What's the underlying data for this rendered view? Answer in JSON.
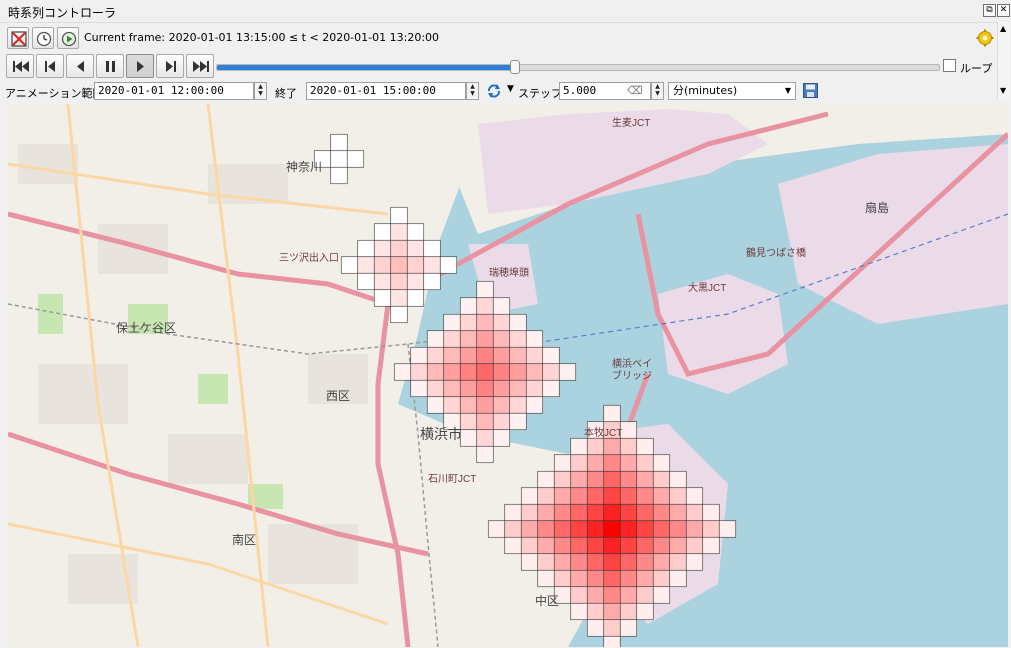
{
  "panel": {
    "title": "時系列コントローラ",
    "restore_symbol": "⧉",
    "close_symbol": "✕"
  },
  "frame": {
    "label": "Current frame: 2020-01-01 13:15:00 ≤ t < 2020-01-01 13:20:00"
  },
  "playback": {
    "buttons": [
      "skip-to-start",
      "step-back",
      "play-backward",
      "pause",
      "play-forward",
      "step-forward",
      "skip-to-end"
    ],
    "slider_fraction": 0.413,
    "loop_label": "ループ",
    "loop_checked": false
  },
  "range": {
    "animation_range_label": "アニメーション範囲",
    "start": "2020-01-01 12:00:00",
    "end_label": "終了",
    "end": "2020-01-01 15:00:00",
    "step_label": "ステップ",
    "step_value": "5.000",
    "unit": "分(minutes)"
  },
  "map": {
    "labels": [
      {
        "name": "kanagawa",
        "text": "神奈川"
      },
      {
        "name": "hodogaya-ku",
        "text": "保土ケ谷区"
      },
      {
        "name": "nishi-ku",
        "text": "西区"
      },
      {
        "name": "yokohama-shi",
        "text": "横浜市"
      },
      {
        "name": "minami-ku",
        "text": "南区"
      },
      {
        "name": "naka-ku",
        "text": "中区"
      },
      {
        "name": "ogishima",
        "text": "扇島"
      },
      {
        "name": "mizuho-pier",
        "text": "瑞穂埠頭"
      },
      {
        "name": "yokohama-bay-bridge",
        "text": "横浜ベイ\nブリッジ"
      },
      {
        "name": "tsurumi-tsubasa",
        "text": "鶴見つばさ橋"
      },
      {
        "name": "daikoku-jct",
        "text": "大黒JCT"
      },
      {
        "name": "namamugi-jct",
        "text": "生麦JCT"
      },
      {
        "name": "honmoku-jct",
        "text": "本牧JCT"
      },
      {
        "name": "ishikawacho",
        "text": "石川町JCT"
      },
      {
        "name": "mitsuzawa",
        "text": "三ツ沢出入口"
      }
    ],
    "colors": {
      "water": "#aad3df",
      "land": "#f2efe9",
      "industrial": "#ebdbe8",
      "motorway": "#e892a2",
      "cell_border": "#333333"
    }
  }
}
